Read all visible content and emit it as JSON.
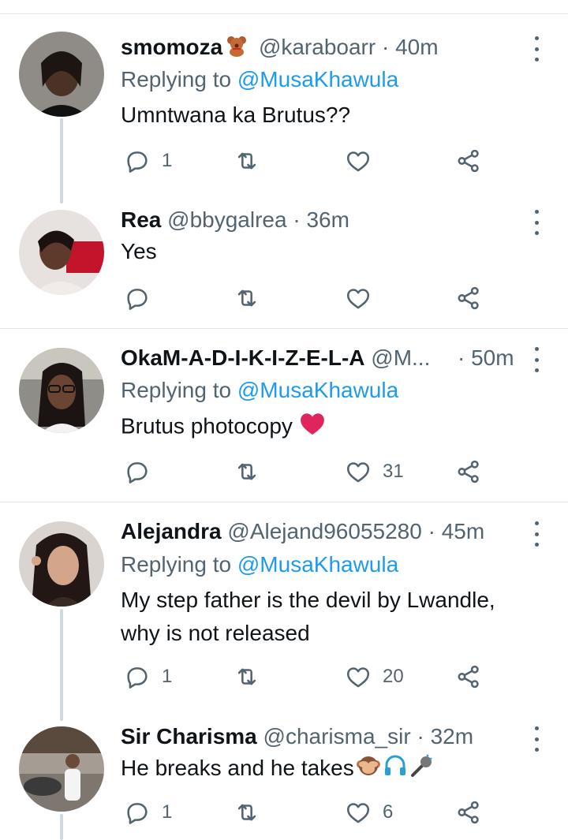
{
  "tweets": [
    {
      "name": "smomoza",
      "name_emoji": "teddy-bear-icon",
      "handle": "@karaboarr",
      "time": "40m",
      "reply_prefix": "Replying to",
      "reply_to": "@MusaKhawula",
      "text": "Umntwana ka Brutus??",
      "reply_count": "1",
      "retweet_count": "",
      "like_count": ""
    },
    {
      "name": "Rea",
      "handle": "@bbygalrea",
      "time": "36m",
      "text": "Yes",
      "reply_count": "",
      "retweet_count": "",
      "like_count": ""
    },
    {
      "name": "OkaM-A-D-I-K-I-Z-E-L-A",
      "handle": "@M...",
      "time": "50m",
      "reply_prefix": "Replying to",
      "reply_to": "@MusaKhawula",
      "text": "Brutus photocopy",
      "text_emoji": "red-heart-icon",
      "reply_count": "",
      "retweet_count": "",
      "like_count": "31"
    },
    {
      "name": "Alejandra",
      "handle": "@Alejand96055280",
      "time": "45m",
      "reply_prefix": "Replying to",
      "reply_to": "@MusaKhawula",
      "text_line1": "My step father is the devil by Lwandle,",
      "text_line2": "why is not released",
      "reply_count": "1",
      "retweet_count": "",
      "like_count": "20"
    },
    {
      "name": "Sir Charisma",
      "handle": "@charisma_sir",
      "time": "32m",
      "text": "He breaks and he takes",
      "text_emojis": [
        "see-no-evil-monkey-icon",
        "headphone-icon",
        "microphone-icon"
      ],
      "reply_count": "1",
      "retweet_count": "",
      "like_count": "6"
    }
  ],
  "separator": "·",
  "colors": {
    "accent": "#1d9bf0",
    "secondary_text": "#536471",
    "heart_red": "#e0245e",
    "divider": "#e1e6ea"
  }
}
